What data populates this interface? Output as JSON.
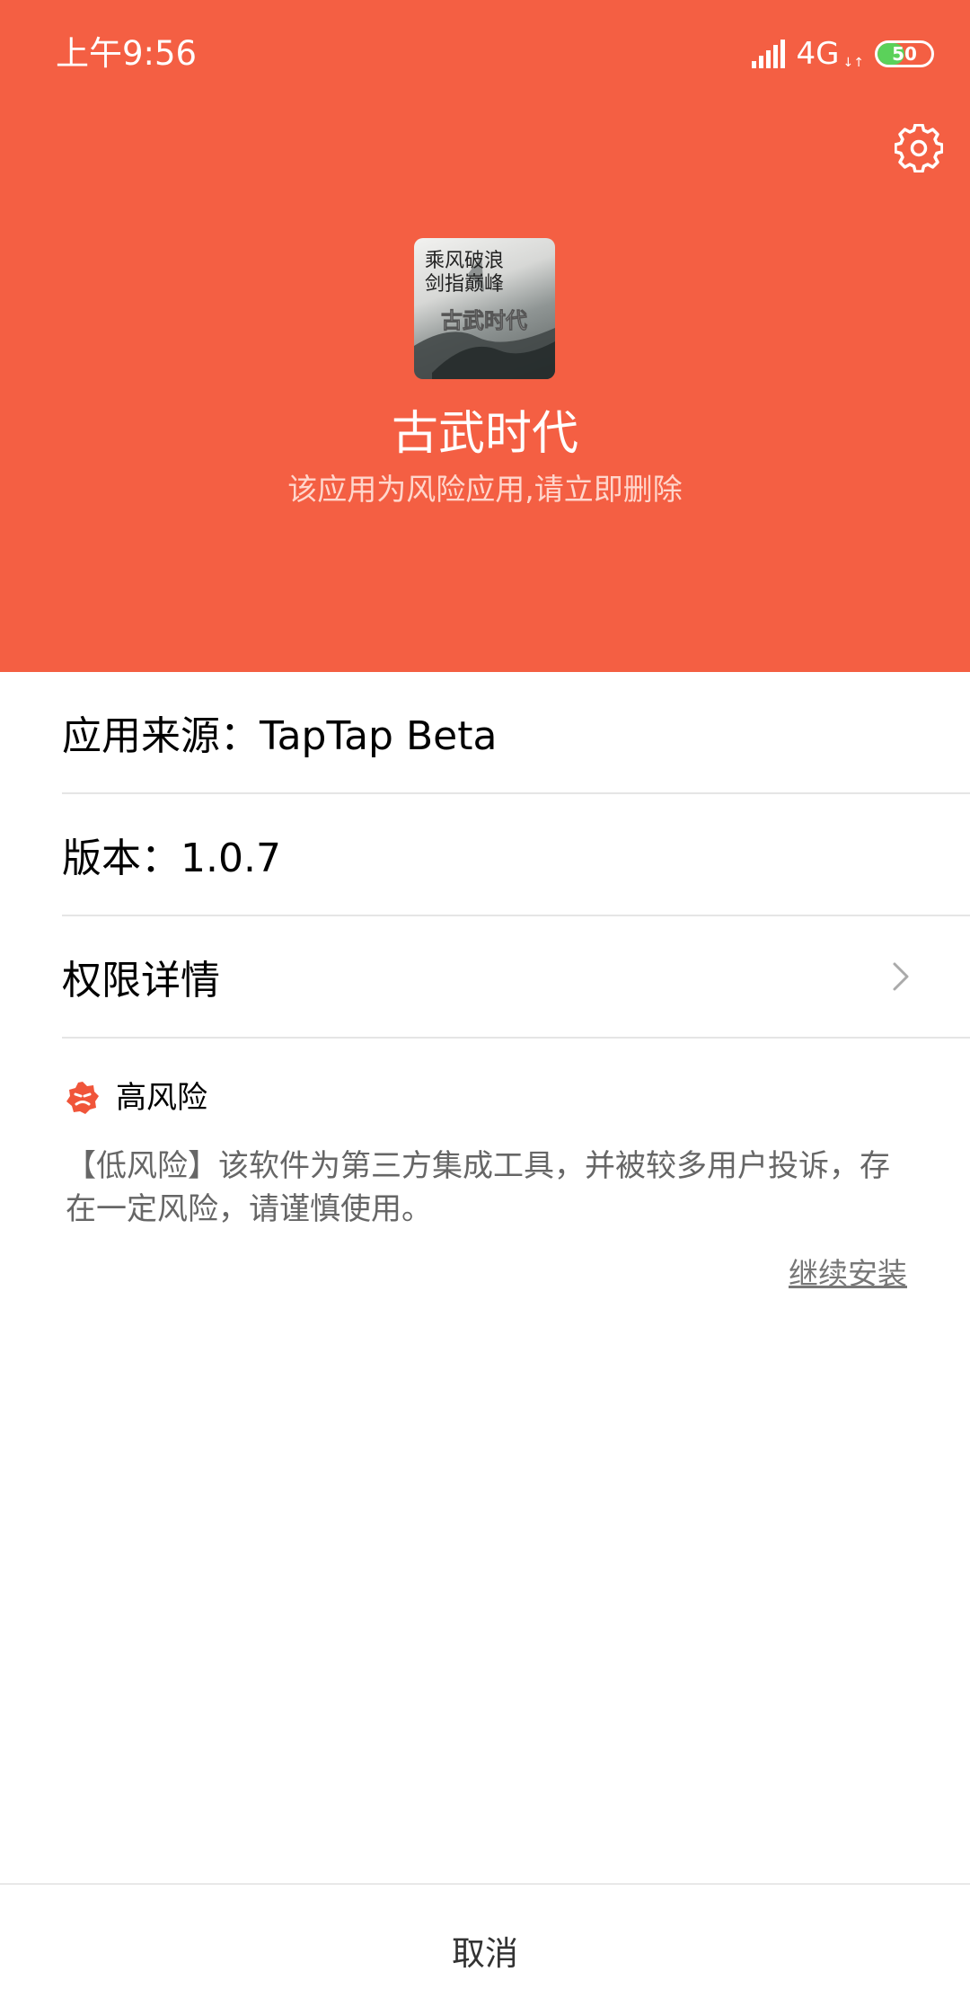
{
  "status_bar": {
    "time": "上午9:56",
    "network": "4G",
    "battery": "50",
    "battery_level": 0.5,
    "signal_icon": "signal-bars-icon",
    "net_arrows": "↓↑"
  },
  "header": {
    "settings_icon": "gear-icon",
    "app_icon": "game-app-icon",
    "app_name": "古武时代",
    "warning": "该应用为风险应用,请立即删除",
    "background_color": "#F45F43"
  },
  "info": {
    "source": "应用来源：TapTap Beta",
    "version": "版本：1.0.7",
    "permissions": "权限详情"
  },
  "risk": {
    "badge_icon": "risk-badge-icon",
    "level": "高风险",
    "description": "【低风险】该软件为第三方集成工具，并被较多用户投诉，存在一定风险，请谨慎使用。",
    "continue_label": "继续安装"
  },
  "footer": {
    "cancel_label": "取消"
  }
}
